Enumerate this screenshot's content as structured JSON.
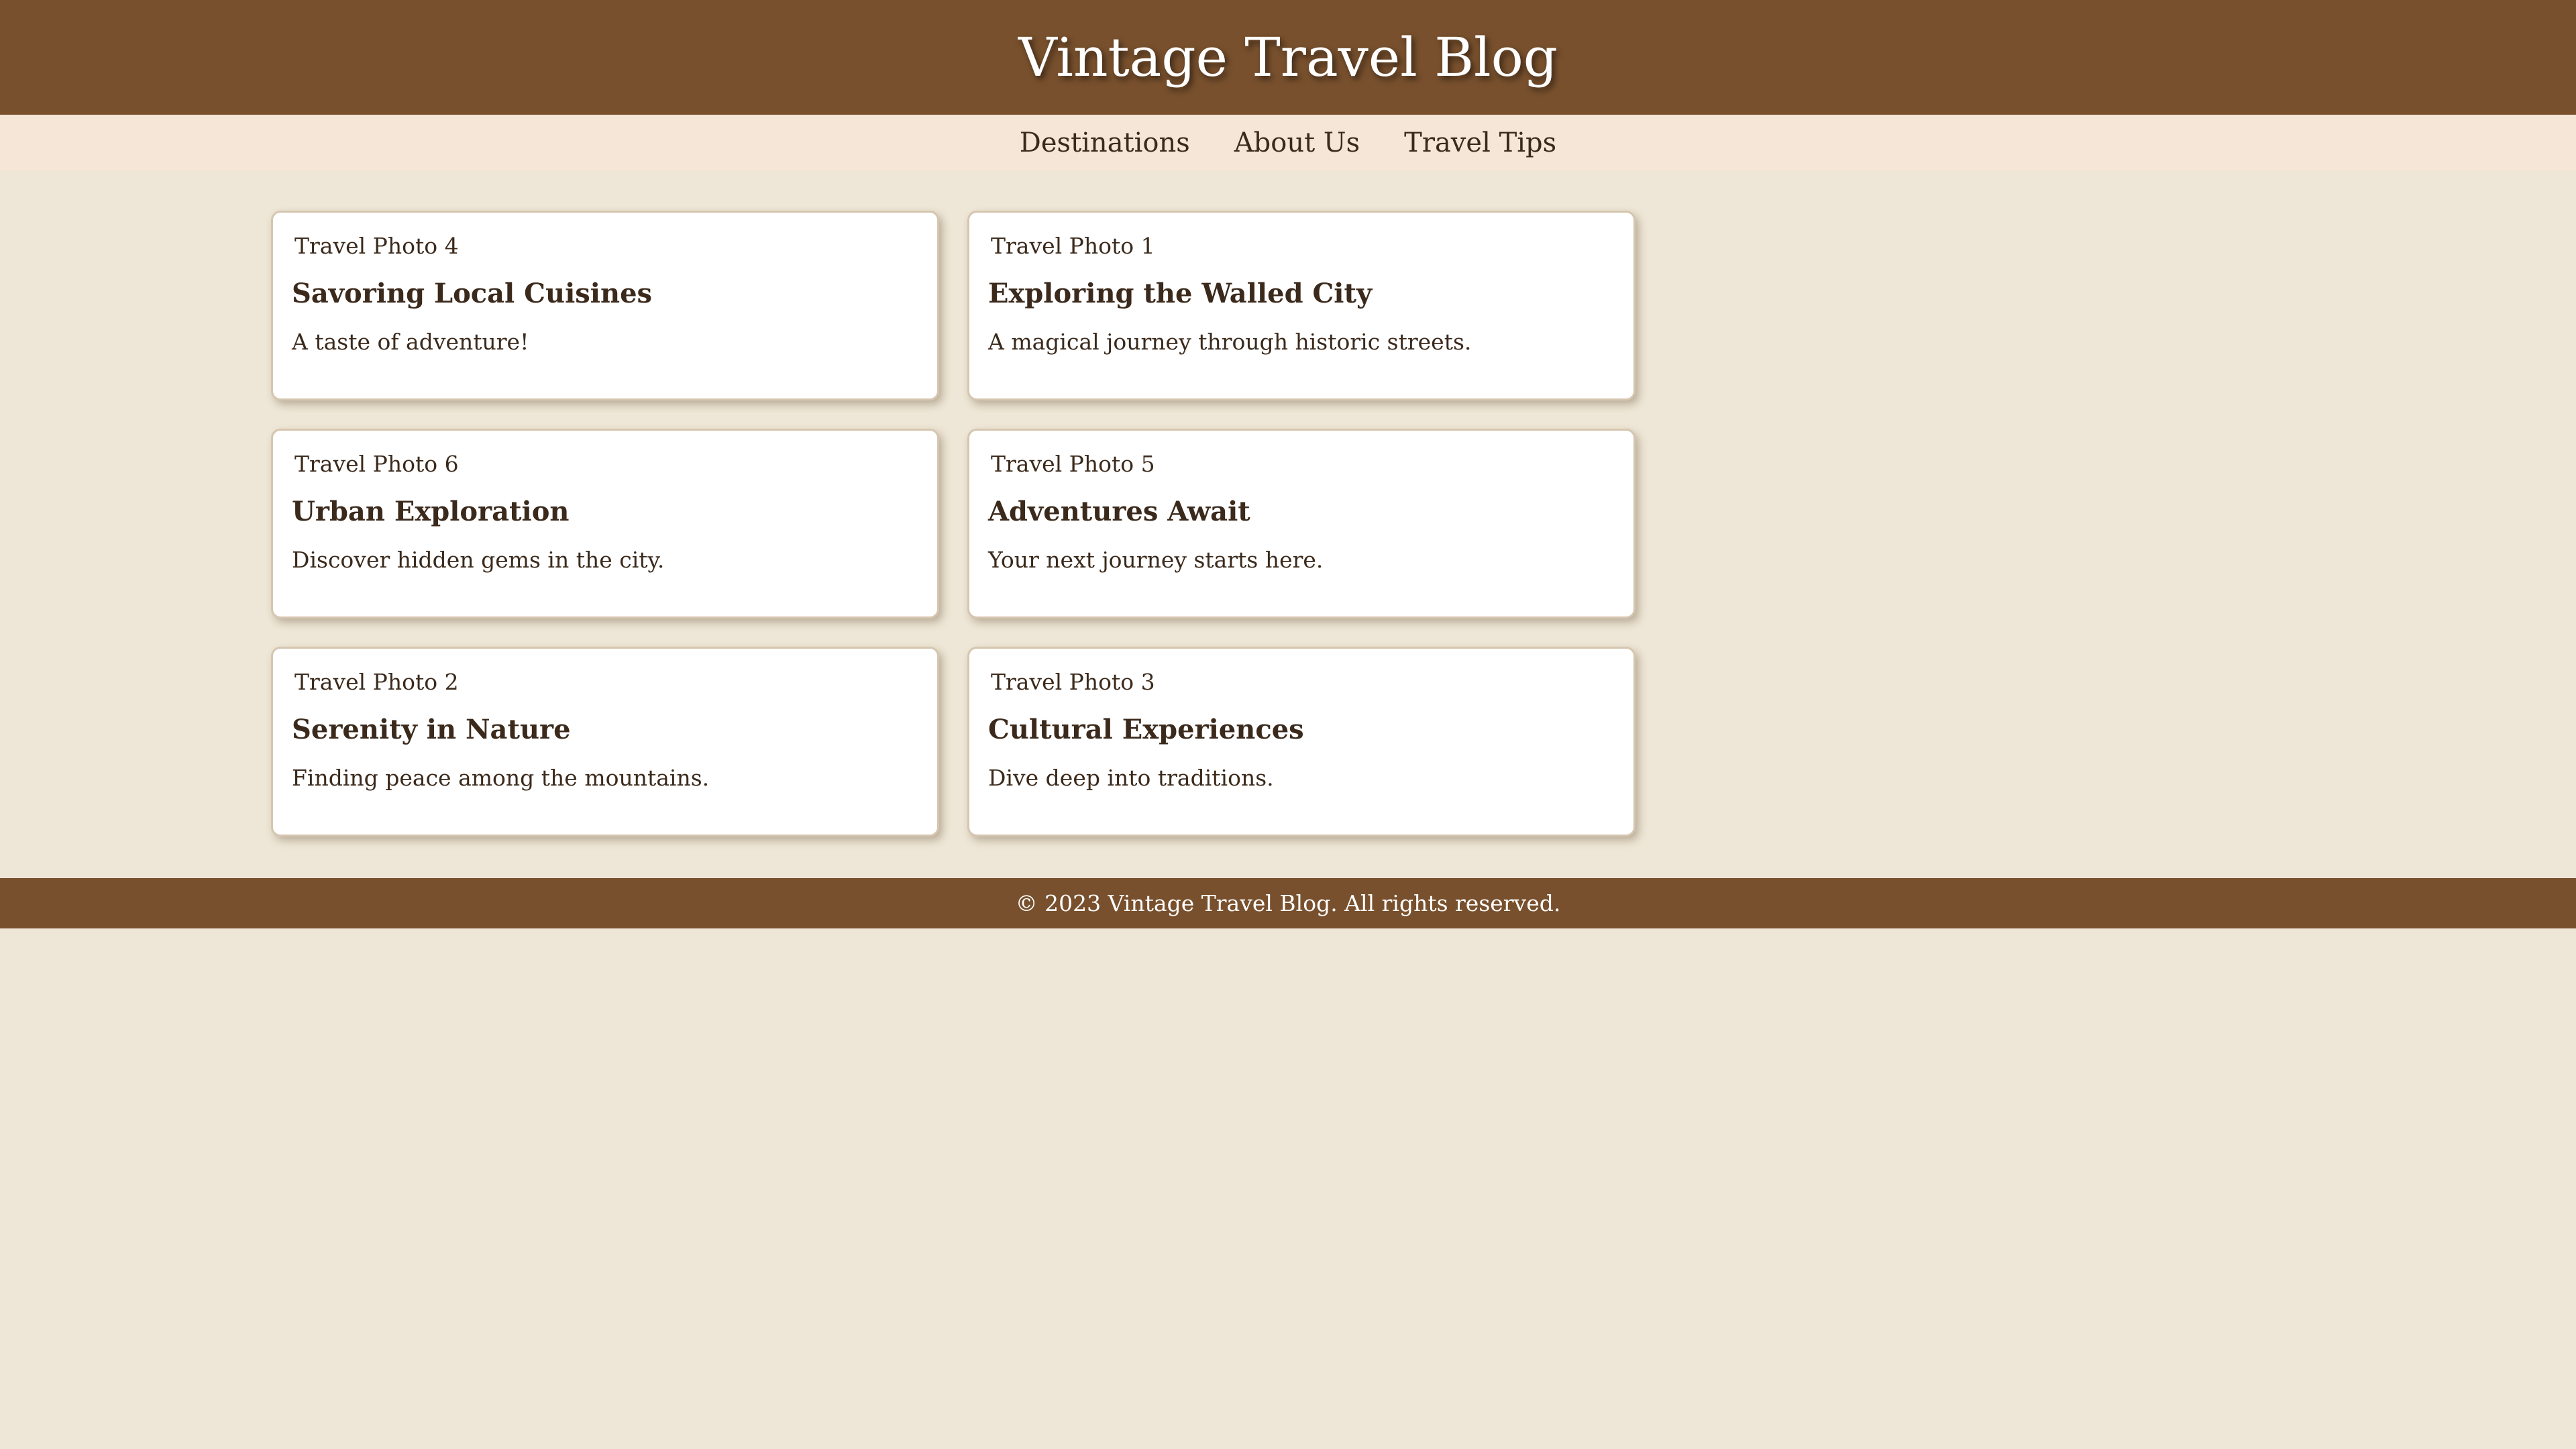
{
  "header": {
    "title": "Vintage Travel Blog"
  },
  "nav": {
    "items": [
      {
        "label": "Destinations"
      },
      {
        "label": "About Us"
      },
      {
        "label": "Travel Tips"
      }
    ]
  },
  "cards": [
    {
      "image_alt": "Travel Photo 4",
      "title": "Savoring Local Cuisines",
      "description": "A taste of adventure!"
    },
    {
      "image_alt": "Travel Photo 1",
      "title": "Exploring the Walled City",
      "description": "A magical journey through historic streets."
    },
    {
      "image_alt": "Travel Photo 6",
      "title": "Urban Exploration",
      "description": "Discover hidden gems in the city."
    },
    {
      "image_alt": "Travel Photo 5",
      "title": "Adventures Await",
      "description": "Your next journey starts here."
    },
    {
      "image_alt": "Travel Photo 2",
      "title": "Serenity in Nature",
      "description": "Finding peace among the mountains."
    },
    {
      "image_alt": "Travel Photo 3",
      "title": "Cultural Experiences",
      "description": "Dive deep into traditions."
    }
  ],
  "footer": {
    "text": "© 2023 Vintage Travel Blog. All rights reserved."
  },
  "colors": {
    "header_bg": "#78502D",
    "nav_bg": "#F5E6D7",
    "page_bg": "#EEE6D6",
    "card_bg": "#FFFFFF",
    "text": "#3B2A1C"
  }
}
